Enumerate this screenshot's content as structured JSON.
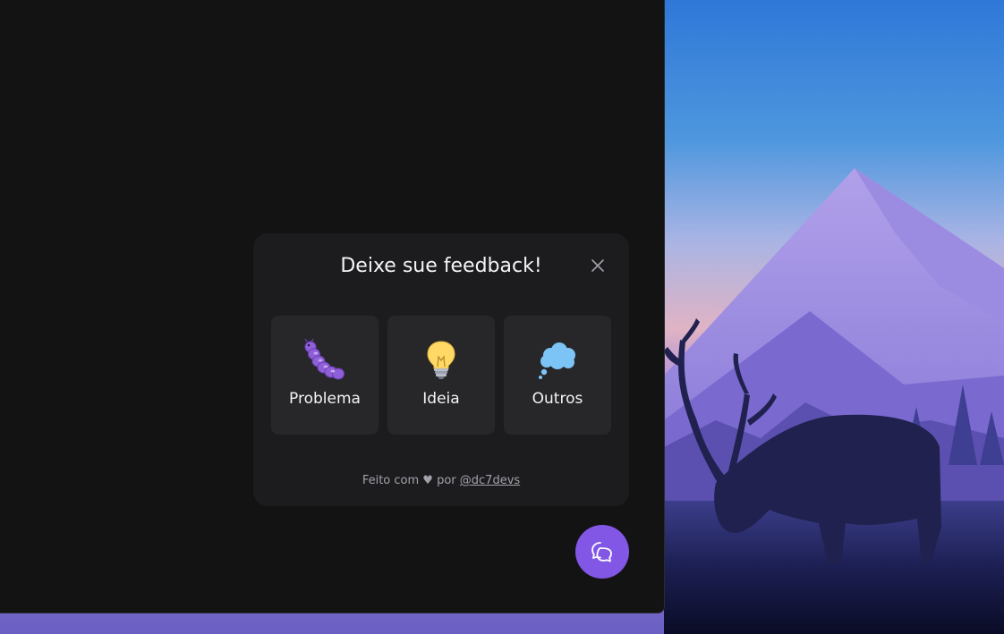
{
  "widget": {
    "title": "Deixe sue feedback!",
    "close_icon": "close-icon",
    "types": [
      {
        "label": "Problema",
        "icon": "bug-icon"
      },
      {
        "label": "Ideia",
        "icon": "lightbulb-icon"
      },
      {
        "label": "Outros",
        "icon": "thought-cloud-icon"
      }
    ],
    "footer": {
      "prefix": "Feito com",
      "heart": "♥",
      "by": "por",
      "link": "@dc7devs"
    }
  },
  "launcher": {
    "icon": "chat-bubbles-icon"
  },
  "colors": {
    "accent": "#8257e5",
    "surface": "#1c1c1f",
    "button": "#27272a",
    "window": "#131314",
    "text": "#f4f4f5",
    "muted": "#a1a1aa"
  }
}
